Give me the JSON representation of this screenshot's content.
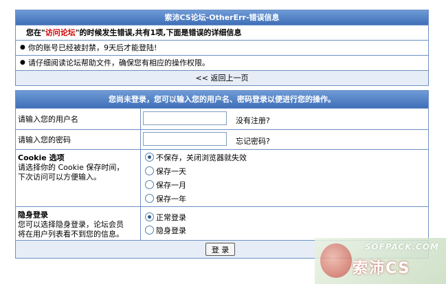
{
  "error_panel": {
    "title": "索沛CS论坛-OtherErr-错误信息",
    "message_pre": "您在\"",
    "message_red": "访问论坛",
    "message_post": "\"的时候发生错误,共有1项,下面是错误的详细信息",
    "items": [
      "你的账号已经被封禁，9天后才能登陆!",
      "请仔细阅读论坛帮助文件，确保您有相应的操作权限。"
    ],
    "back_link": "<< 返回上一页"
  },
  "login_panel": {
    "title": "您尚未登录，您可以输入您的用户名、密码登录以便进行您的操作。",
    "username_label": "请输入您的用户名",
    "username_value": "",
    "register_link": "没有注册?",
    "password_label": "请输入您的密码",
    "password_value": "",
    "forgot_link": "忘记密码?",
    "cookie_title": "Cookie 选项",
    "cookie_desc_1": "请选择你的 Cookie 保存时间，",
    "cookie_desc_2": "下次访问可以方便输入。",
    "cookie_options": [
      "不保存，关闭浏览器就失效",
      "保存一天",
      "保存一月",
      "保存一年"
    ],
    "cookie_selected": 0,
    "hidden_title": "隐身登录",
    "hidden_desc_1": "您可以选择隐身登录，论坛会员",
    "hidden_desc_2": "将在用户列表看不到您的信息。",
    "hidden_options": [
      "正常登录",
      "隐身登录"
    ],
    "hidden_selected": 0,
    "login_button": "登 录"
  },
  "watermark": {
    "top": "SOFPACK.COM",
    "main": "索沛CS"
  }
}
